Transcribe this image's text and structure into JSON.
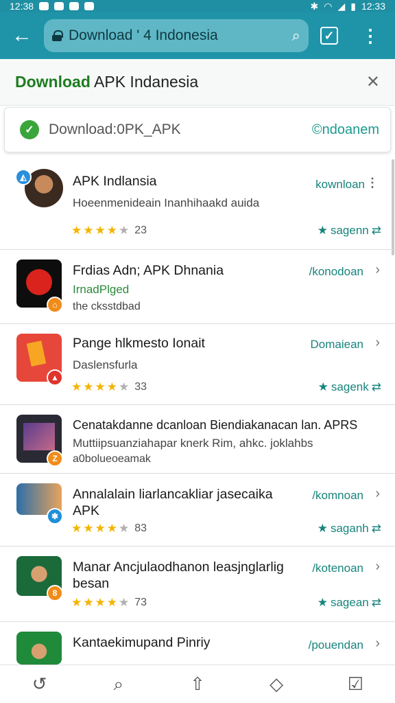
{
  "status": {
    "time_left": "12:38",
    "time_right": "12:33"
  },
  "toolbar": {
    "url": "Download ' 4 Indonesia"
  },
  "header": {
    "title_accent": "Download",
    "title_rest": " APK Indanesia"
  },
  "search": {
    "query": "Download:0PK_APK",
    "link": "©ndoanem"
  },
  "items": [
    {
      "title": "APK Indlansia",
      "subtitle": "Hoeenmenideain Inanhihaakd auida",
      "rating_stars": 4,
      "rating_count": "23",
      "action": "kownloan",
      "meta": "sagenn"
    },
    {
      "title": "Frdias Adn; APK Dhnania",
      "subtitle": "IrnadPlged",
      "subtitle2": "the cksstdbad",
      "action": "/konodoan"
    },
    {
      "title": "Pange hlkmesto Ionait",
      "subtitle": "Daslensfurla",
      "rating_stars": 4,
      "rating_count": "33",
      "action": "Domaiean",
      "meta": "sagenk"
    },
    {
      "title": "Cenatakdanne dcanloan Biendiakanacan lan. APRS",
      "subtitle": "Muttiipsuanziahapar knerk Rim, ahkc. joklahbs",
      "subtitle2": "a0bolueoeamak",
      "action": ""
    },
    {
      "title": "Annalalain liarlancakliar jasecaika APK",
      "rating_stars": 4,
      "rating_count": "83",
      "action": "/komnoan",
      "meta": "saganh"
    },
    {
      "title": "Manar Ancjulaodhanon leasjnglarlig besan",
      "rating_stars": 4,
      "rating_count": "73",
      "action": "/kotenoan",
      "meta": "sagean"
    },
    {
      "title": "Kantaekimupand Pinriy",
      "action": "/pouendan"
    }
  ],
  "colors": {
    "toolbar": "#1f94a8",
    "accent_green": "#1d7d1e",
    "link_teal": "#17847c",
    "star": "#f4b400"
  }
}
